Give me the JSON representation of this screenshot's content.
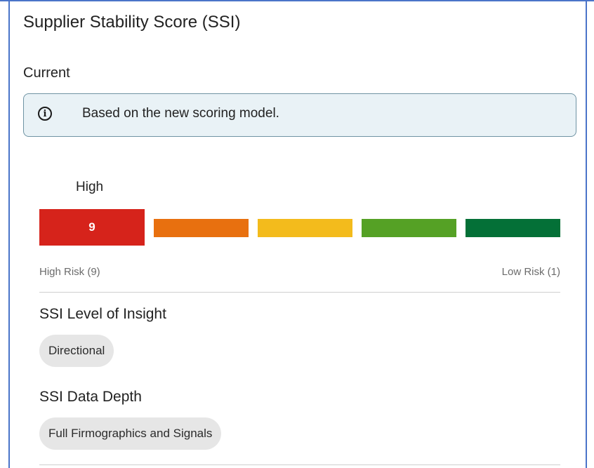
{
  "panel": {
    "title": "Supplier Stability Score (SSI)",
    "period_label": "Current"
  },
  "info": {
    "icon": "info-circle-icon",
    "text": "Based on the new scoring model."
  },
  "score": {
    "level_label": "High",
    "value": "9",
    "segments": [
      {
        "color": "#d6231b",
        "active": true
      },
      {
        "color": "#e8700f",
        "active": false
      },
      {
        "color": "#f3bb1c",
        "active": false
      },
      {
        "color": "#55a125",
        "active": false
      },
      {
        "color": "#047037",
        "active": false
      }
    ],
    "scale_high": "High Risk (9)",
    "scale_low": "Low Risk (1)"
  },
  "insight": {
    "heading": "SSI Level of Insight",
    "value": "Directional"
  },
  "depth": {
    "heading": "SSI Data Depth",
    "value": "Full Firmographics and Signals"
  }
}
